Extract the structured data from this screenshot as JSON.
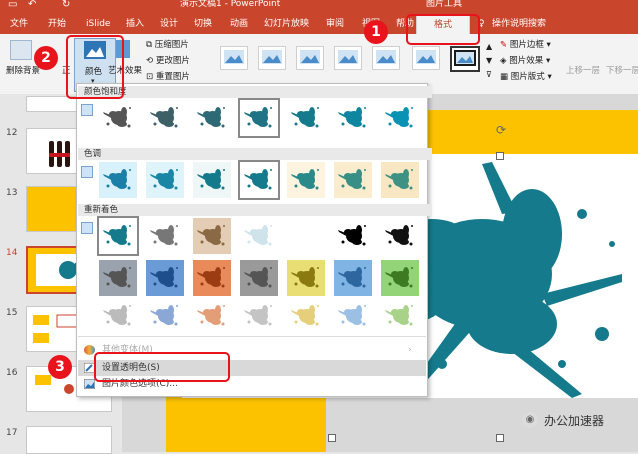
{
  "window": {
    "title": "演示文稿1 - PowerPoint",
    "context_tab_group": "图片工具"
  },
  "tabs": [
    "文件",
    "开始",
    "iSlide",
    "插入",
    "设计",
    "切换",
    "动画",
    "幻灯片放映",
    "审阅",
    "视图",
    "帮助",
    "格式",
    "操作说明搜索"
  ],
  "ribbon": {
    "remove_bg": "删除背景",
    "color": "颜色",
    "artistic": "艺术效果",
    "compress": "压缩图片",
    "change": "更改图片",
    "reset": "重置图片",
    "border": "图片边框",
    "effects": "图片效果",
    "layout": "图片版式",
    "bring_forward": "上移一层",
    "send_backward": "下移一层"
  },
  "dropdown": {
    "saturation_header": "颜色饱和度",
    "tone_header": "色调",
    "recolor_header": "重新着色",
    "menu_more_variants": "其他变体(M)",
    "menu_set_transparent": "设置透明色(S)",
    "menu_picture_color_options": "图片颜色选项(C)..."
  },
  "slides": {
    "numbers": [
      "12",
      "13",
      "14",
      "15",
      "16",
      "17"
    ],
    "current": "14"
  },
  "callouts": [
    "1",
    "2",
    "3"
  ],
  "watermark": "办公加速器",
  "colors": {
    "accent_red": "#c9462d",
    "callout_red": "#e8131b",
    "slide_yellow": "#fcc200",
    "splash_teal": "#157a8c"
  }
}
